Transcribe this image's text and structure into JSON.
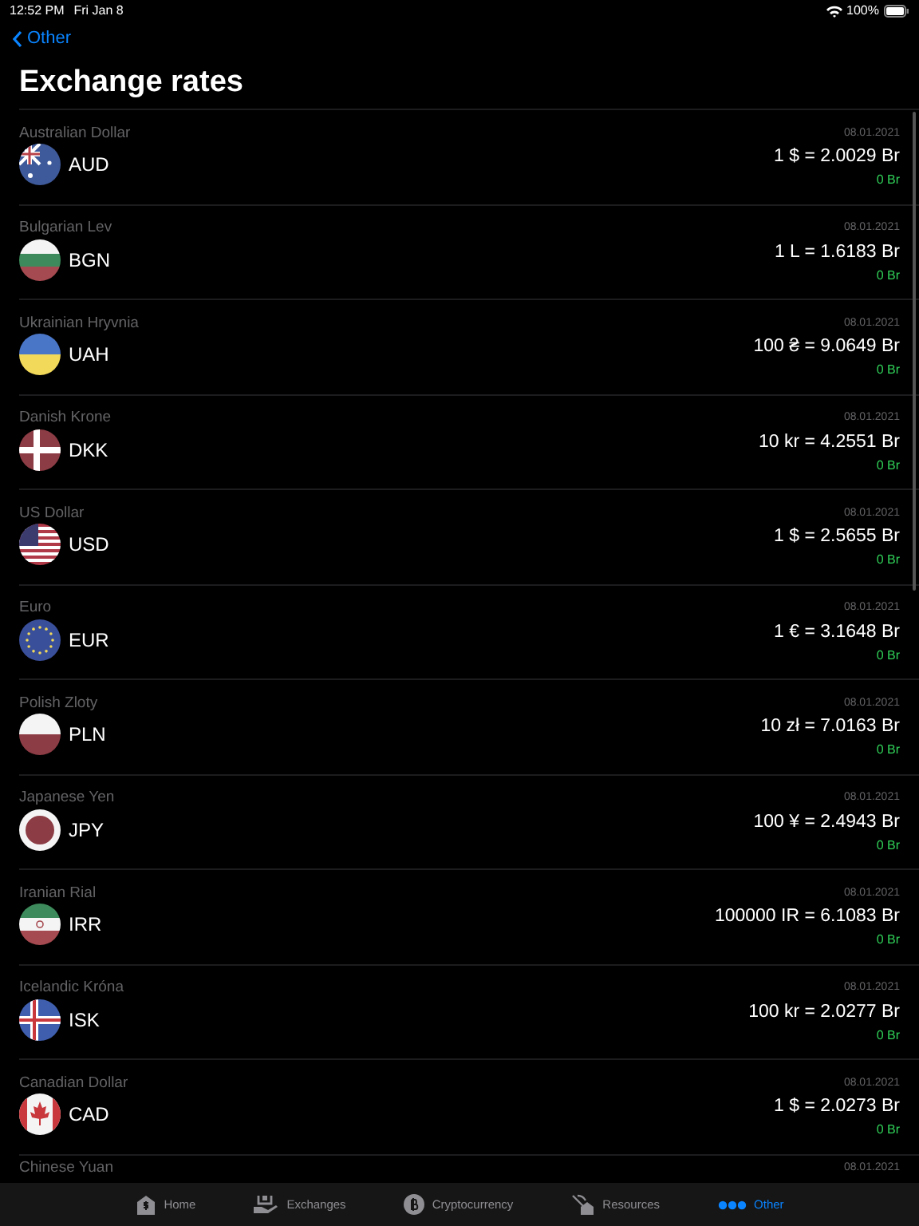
{
  "status_bar": {
    "time": "12:52 PM",
    "date": "Fri Jan 8",
    "battery": "100%"
  },
  "nav": {
    "back": "Other",
    "title": "Exchange rates"
  },
  "rates": [
    {
      "name": "Australian Dollar",
      "code": "AUD",
      "kind": "au",
      "date": "08.01.2021",
      "rate": "1 $ = 2.0029 Br",
      "change": "0 Br"
    },
    {
      "name": "Bulgarian Lev",
      "code": "BGN",
      "kind": "bg",
      "date": "08.01.2021",
      "rate": "1 L = 1.6183 Br",
      "change": "0 Br"
    },
    {
      "name": "Ukrainian Hryvnia",
      "code": "UAH",
      "kind": "ua",
      "date": "08.01.2021",
      "rate": "100 ₴ = 9.0649 Br",
      "change": "0 Br"
    },
    {
      "name": "Danish Krone",
      "code": "DKK",
      "kind": "dk",
      "date": "08.01.2021",
      "rate": "10 kr = 4.2551 Br",
      "change": "0 Br"
    },
    {
      "name": "US Dollar",
      "code": "USD",
      "kind": "us",
      "date": "08.01.2021",
      "rate": "1 $ = 2.5655 Br",
      "change": "0 Br"
    },
    {
      "name": "Euro",
      "code": "EUR",
      "kind": "eu",
      "date": "08.01.2021",
      "rate": "1 € = 3.1648 Br",
      "change": "0 Br"
    },
    {
      "name": "Polish Zloty",
      "code": "PLN",
      "kind": "pl",
      "date": "08.01.2021",
      "rate": "10 zł = 7.0163 Br",
      "change": "0 Br"
    },
    {
      "name": "Japanese Yen",
      "code": "JPY",
      "kind": "jp",
      "date": "08.01.2021",
      "rate": "100 ¥ = 2.4943 Br",
      "change": "0 Br"
    },
    {
      "name": "Iranian Rial",
      "code": "IRR",
      "kind": "ir",
      "date": "08.01.2021",
      "rate": "100000 IR = 6.1083 Br",
      "change": "0 Br"
    },
    {
      "name": "Icelandic Króna",
      "code": "ISK",
      "kind": "is",
      "date": "08.01.2021",
      "rate": "100 kr = 2.0277 Br",
      "change": "0 Br"
    },
    {
      "name": "Canadian Dollar",
      "code": "CAD",
      "kind": "ca",
      "date": "08.01.2021",
      "rate": "1 $ = 2.0273 Br",
      "change": "0 Br"
    },
    {
      "name": "Chinese Yuan",
      "date": "08.01.2021"
    }
  ],
  "tabs": [
    {
      "label": "Home",
      "kind": "home",
      "selected": false
    },
    {
      "label": "Exchanges",
      "kind": "exchanges",
      "selected": false
    },
    {
      "label": "Cryptocurrency",
      "kind": "crypto",
      "selected": false
    },
    {
      "label": "Resources",
      "kind": "resources",
      "selected": false
    },
    {
      "label": "Other",
      "kind": "other",
      "selected": true
    }
  ]
}
